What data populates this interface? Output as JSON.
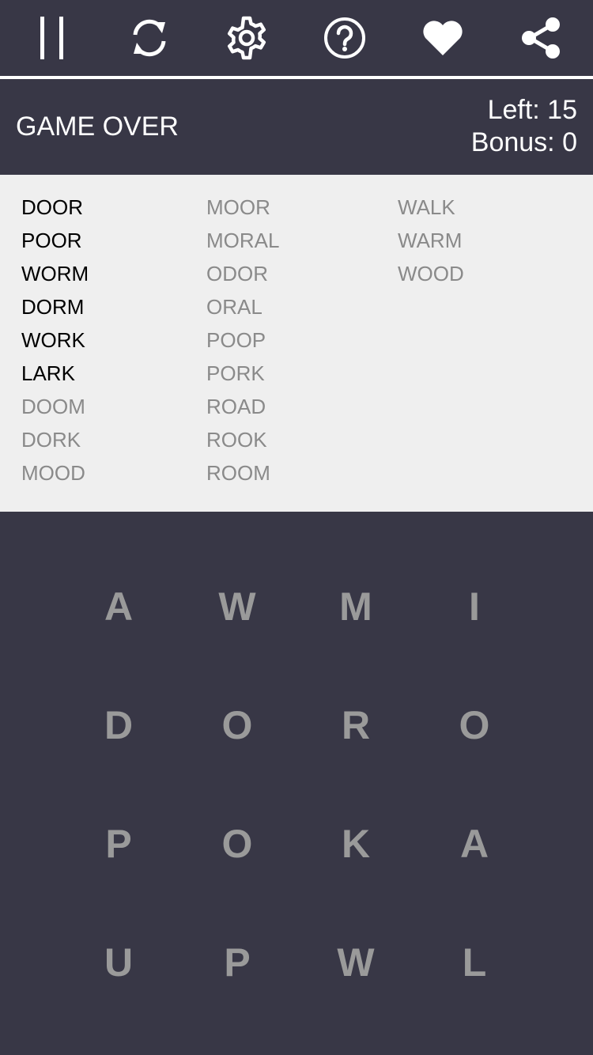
{
  "colors": {
    "background": "#383746",
    "divider": "#ffffff",
    "word_panel": "#efefef",
    "found_word": "#000000",
    "missed_word": "#8a8a8a",
    "tile_letter": "#9a9a9a"
  },
  "toolbar": {
    "buttons": [
      {
        "icon": "pause-icon"
      },
      {
        "icon": "restart-icon"
      },
      {
        "icon": "settings-gear-icon"
      },
      {
        "icon": "help-icon"
      },
      {
        "icon": "heart-icon"
      },
      {
        "icon": "share-icon"
      }
    ]
  },
  "status": {
    "title": "GAME OVER",
    "left_label": "Left: 15",
    "bonus_label": "Bonus: 0"
  },
  "word_list": {
    "columns": [
      [
        {
          "text": "DOOR",
          "found": true
        },
        {
          "text": "POOR",
          "found": true
        },
        {
          "text": "WORM",
          "found": true
        },
        {
          "text": "DORM",
          "found": true
        },
        {
          "text": "WORK",
          "found": true
        },
        {
          "text": "LARK",
          "found": true
        },
        {
          "text": "DOOM",
          "found": false
        },
        {
          "text": "DORK",
          "found": false
        },
        {
          "text": "MOOD",
          "found": false
        }
      ],
      [
        {
          "text": "MOOR",
          "found": false
        },
        {
          "text": "MORAL",
          "found": false
        },
        {
          "text": "ODOR",
          "found": false
        },
        {
          "text": "ORAL",
          "found": false
        },
        {
          "text": "POOP",
          "found": false
        },
        {
          "text": "PORK",
          "found": false
        },
        {
          "text": "ROAD",
          "found": false
        },
        {
          "text": "ROOK",
          "found": false
        },
        {
          "text": "ROOM",
          "found": false
        }
      ],
      [
        {
          "text": "WALK",
          "found": false
        },
        {
          "text": "WARM",
          "found": false
        },
        {
          "text": "WOOD",
          "found": false
        }
      ]
    ]
  },
  "letter_grid": {
    "rows": [
      [
        "A",
        "W",
        "M",
        "I"
      ],
      [
        "D",
        "O",
        "R",
        "O"
      ],
      [
        "P",
        "O",
        "K",
        "A"
      ],
      [
        "U",
        "P",
        "W",
        "L"
      ]
    ]
  }
}
